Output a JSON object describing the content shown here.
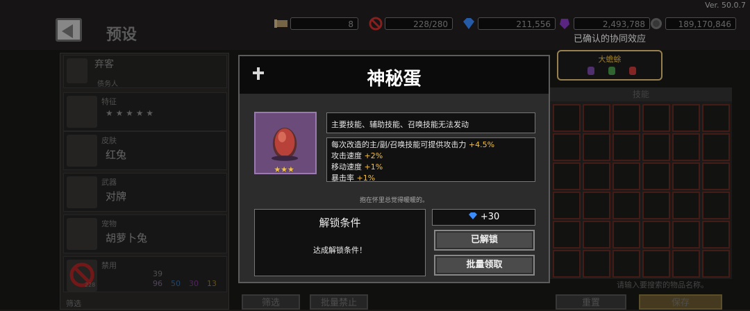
{
  "header": {
    "title": "预设",
    "version": "Ver. 50.0.7",
    "resources": [
      {
        "icon": "scroll-icon",
        "value": "8"
      },
      {
        "icon": "ban-icon",
        "value": "228/280"
      },
      {
        "icon": "gem-icon",
        "value": "211,556"
      },
      {
        "icon": "purple-crystal-icon",
        "value": "2,493,788"
      },
      {
        "icon": "coin-icon",
        "value": "189,170,846"
      }
    ]
  },
  "synergy": {
    "label": "已确认的协同效应",
    "name": "大蟾蜍"
  },
  "left_panel": {
    "character": {
      "small": "弃客",
      "sub": "债务人"
    },
    "rows": [
      {
        "small": "特征",
        "big": ""
      },
      {
        "small": "皮肤",
        "big": "红兔"
      },
      {
        "small": "武器",
        "big": "对牌"
      },
      {
        "small": "宠物",
        "big": "胡萝卜兔"
      },
      {
        "small": "禁用",
        "big": ""
      }
    ],
    "ban_count": "228",
    "ban_total": "39",
    "ban_stats": [
      "96",
      "50",
      "30",
      "13"
    ],
    "bottom_label": "筛选"
  },
  "right_panel": {
    "tab": "技能",
    "search_hint": "请输入要搜索的物品名称。",
    "buttons": [
      "重置",
      "保存"
    ]
  },
  "bottom_buttons": [
    "筛选",
    "批量禁止"
  ],
  "dialog": {
    "title": "神秘蛋",
    "stars": "★★★",
    "desc_main": "主要技能、辅助技能、召唤技能无法发动",
    "effects": [
      {
        "text": "每次改造的主/副/召唤技能可提供攻击力",
        "value": "+4.5%"
      },
      {
        "text": "攻击速度",
        "value": "+2%"
      },
      {
        "text": "移动速度",
        "value": "+1%"
      },
      {
        "text": "暴击率",
        "value": "+1%"
      }
    ],
    "flavor": "抱在怀里总觉得暖暖的。",
    "unlock_title": "解锁条件",
    "unlock_text": "达成解锁条件！",
    "gem_reward": "+30",
    "unlocked_label": "已解锁",
    "batch_claim_label": "批量领取"
  },
  "colors": {
    "highlight": "#f2c14a",
    "synergy_border": "#e9c77a"
  }
}
